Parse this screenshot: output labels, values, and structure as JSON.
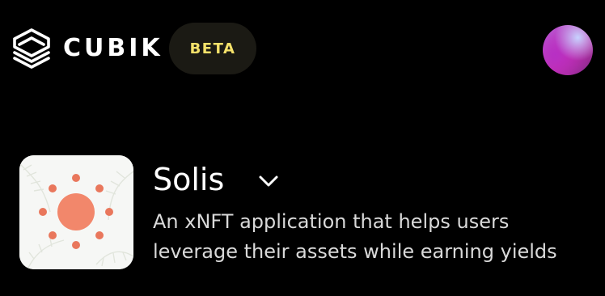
{
  "header": {
    "brand_name": "CUBIK",
    "badge_label": "BETA",
    "logo_icon": "cubik-logo-icon",
    "avatar_icon": "user-avatar"
  },
  "project": {
    "name": "Solis",
    "description": "An xNFT application that helps users leverage their assets while earning yields",
    "thumbnail_icon": "sun-icon",
    "expand_icon": "chevron-down-icon"
  },
  "colors": {
    "background": "#000000",
    "badge_text": "#f4e16a",
    "badge_background": "#1b1a14",
    "sun_core": "#f2876b",
    "sun_rays": "#e9775c"
  }
}
